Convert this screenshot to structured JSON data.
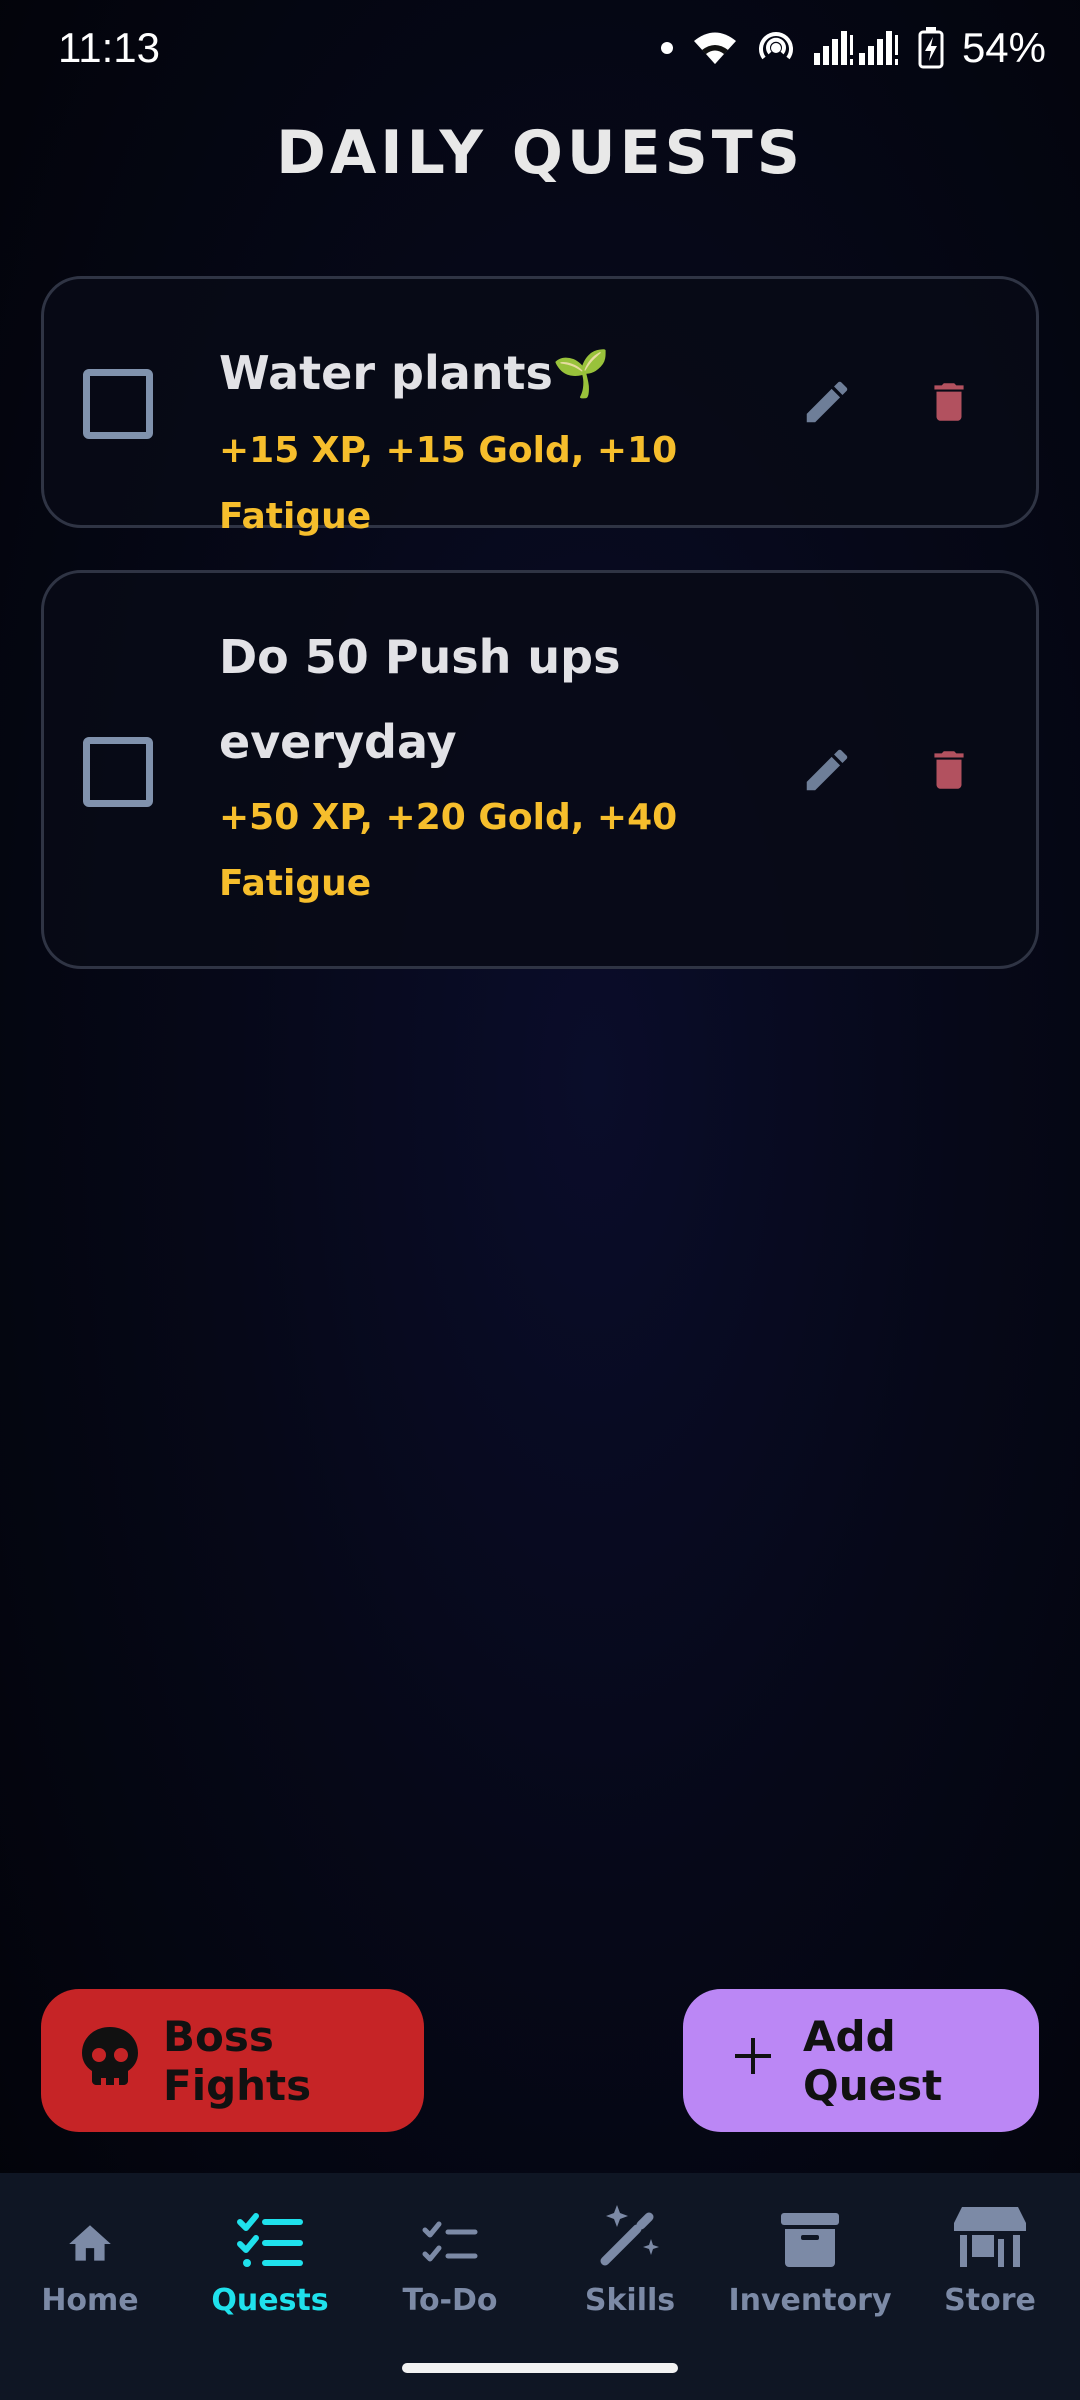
{
  "status_bar": {
    "time": "11:13",
    "battery": "54%"
  },
  "page_title": "DAILY QUESTS",
  "quests": [
    {
      "title": "Water plants🌱",
      "reward": "+15 XP, +15 Gold, +10 Fatigue"
    },
    {
      "title": "Do 50 Push ups everyday",
      "reward": "+50 XP, +20 Gold, +40 Fatigue"
    }
  ],
  "actions": {
    "boss_label": "Boss Fights",
    "add_label": "Add Quest"
  },
  "nav": {
    "items": [
      {
        "label": "Home",
        "icon": "home-icon"
      },
      {
        "label": "Quests",
        "icon": "quests-list-icon"
      },
      {
        "label": "To-Do",
        "icon": "todo-checklist-icon"
      },
      {
        "label": "Skills",
        "icon": "magic-wand-icon"
      },
      {
        "label": "Inventory",
        "icon": "archive-box-icon"
      },
      {
        "label": "Store",
        "icon": "store-icon"
      }
    ],
    "active": "Quests"
  },
  "colors": {
    "background": "#05070f",
    "reward_text": "#f6be2c",
    "boss_button": "#c62426",
    "add_button": "#bb87f5",
    "active_nav": "#1fe1ec",
    "delete_icon": "#b2515f",
    "edit_icon": "#6e7e98"
  }
}
